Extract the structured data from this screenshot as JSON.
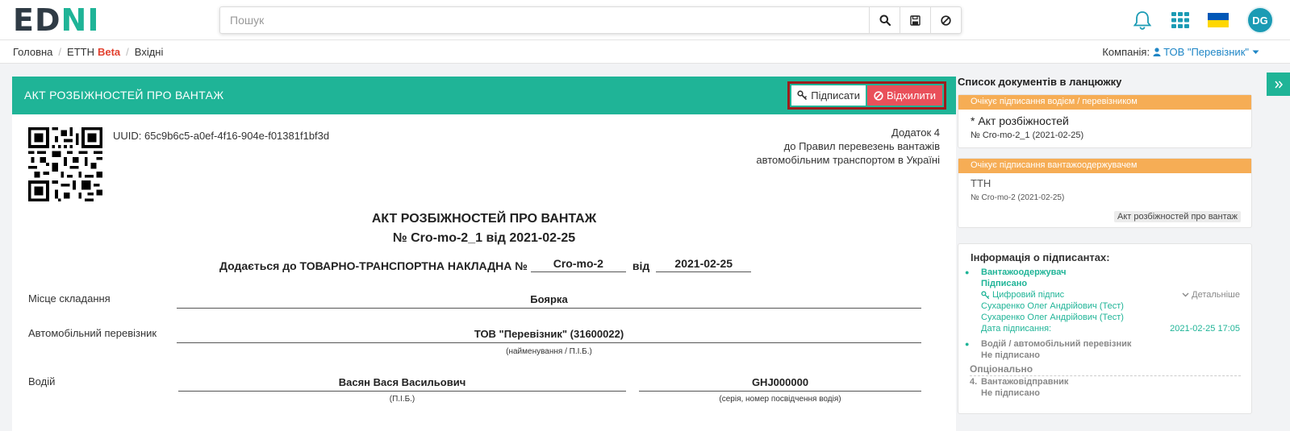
{
  "header": {
    "logo_left": "ED",
    "logo_right": "NI",
    "search_placeholder": "Пошук",
    "avatar_initials": "DG",
    "accent": "#1fb497"
  },
  "breadcrumb": {
    "items": [
      "Головна",
      "ЕТТН",
      "Вхідні"
    ],
    "beta": "Beta",
    "company_label": "Компанія:",
    "company_value": "ТОВ \"Перевізник\""
  },
  "doc": {
    "header_title": "АКТ РОЗБІЖНОСТЕЙ ПРО ВАНТАЖ",
    "sign_label": "Підписати",
    "reject_label": "Відхилити",
    "uuid": "UUID: 65c9b6c5-a0ef-4f16-904e-f01381f1bf3d",
    "appendix": [
      "Додаток 4",
      "до Правил перевезень вантажів",
      "автомобільним транспортом в Україні"
    ],
    "title": "АКТ РОЗБІЖНОСТЕЙ ПРО ВАНТАЖ",
    "subtitle": "№ Cro-mo-2_1 від 2021-02-25",
    "attach_prefix": "Додається до ТОВАРНО-ТРАНСПОРТНА НАКЛАДНА №",
    "attach_number": "Cro-mo-2",
    "attach_from": "від",
    "attach_date": "2021-02-25",
    "place_label": "Місце складання",
    "place_value": "Боярка",
    "carrier_label": "Автомобільний перевізник",
    "carrier_value": "ТОВ \"Перевізник\" (31600022)",
    "carrier_caption": "(найменування / П.І.Б.)",
    "driver_label": "Водій",
    "driver_value": "Васян Вася Васильович",
    "driver_caption": "(П.І.Б.)",
    "license_value": "GHJ000000",
    "license_caption": "(серія, номер посвідчення водія)"
  },
  "chain": {
    "title": "Список документів в ланцюжку",
    "card1": {
      "status": "Очікує підписання водієм / перевізником",
      "name": "* Акт розбіжностей",
      "num": "№ Cro-mo-2_1 (2021-02-25)"
    },
    "card2": {
      "status": "Очікує підписання вантажоодержувачем",
      "name": "ТТН",
      "num": "№ Cro-mo-2 (2021-02-25)",
      "tag": "Акт розбіжностей про вантаж"
    }
  },
  "signers": {
    "title": "Інформація о підписантах:",
    "s1_role": "Вантажоодержувач",
    "s1_status": "Підписано",
    "s1_digital": "Цифровий підпис",
    "s1_details": "Детальніше",
    "s1_name1": "Сухаренко Олег Андрійович (Тест)",
    "s1_name2": "Сухаренко Олег Андрійович (Тест)",
    "s1_date_label": "Дата підписання:",
    "s1_date": "2021-02-25 17:05",
    "s2_role": "Водій / автомобільний перевізник",
    "s2_status": "Не підписано",
    "optional": "Опціонально",
    "s3_num": "4.",
    "s3_role": "Вантажовідправник",
    "s3_status": "Не підписано"
  }
}
